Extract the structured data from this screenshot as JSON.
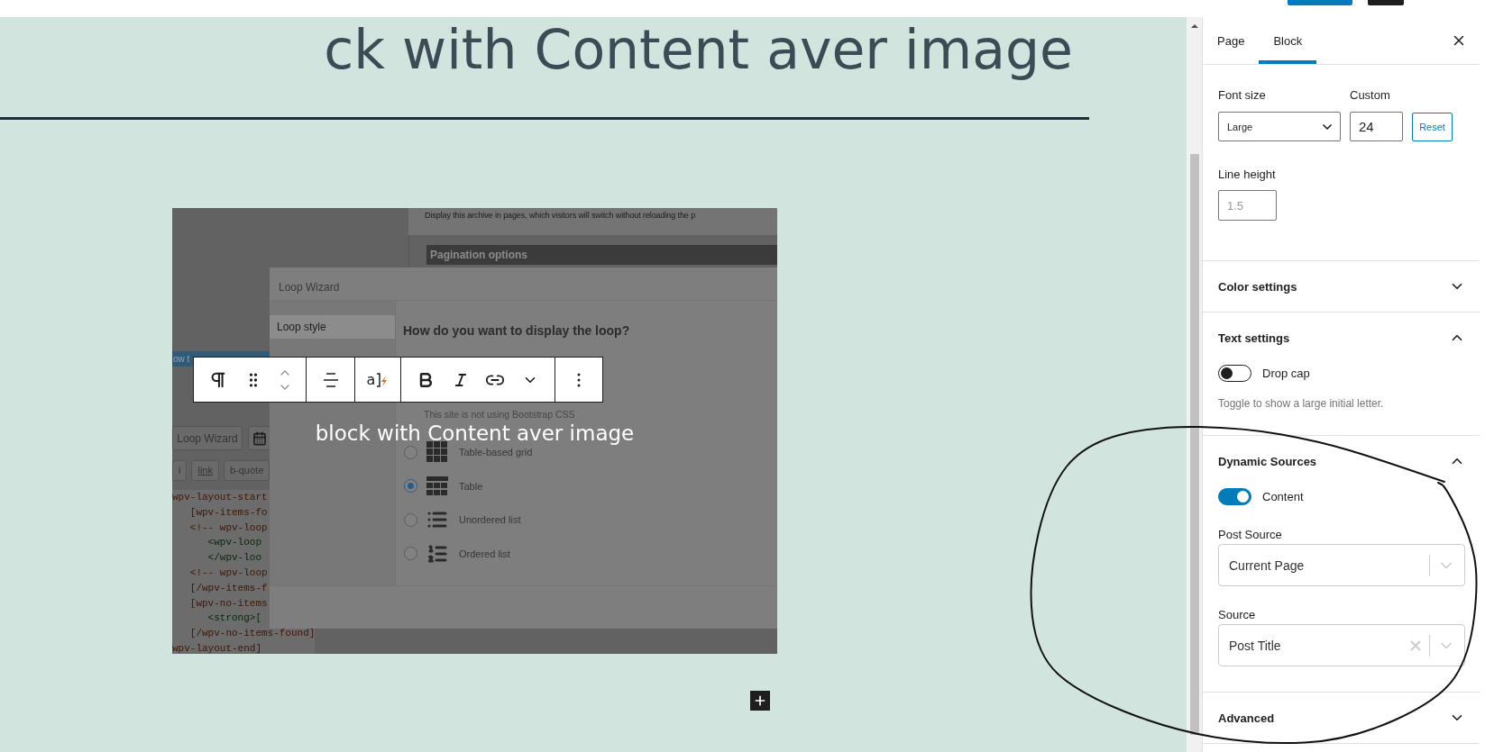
{
  "editor_title": "ck with Content aver image",
  "cover": {
    "text": "block with Content aver image",
    "toolbar": {
      "format_glyph": "a"
    },
    "screenshot": {
      "description": "Display this archive in pages, which visitors will switch without reloading the p",
      "section": "Pagination options",
      "notice": "ow t",
      "button": "Loop Wizard",
      "quicktags": [
        "i",
        "link",
        "b-quote"
      ],
      "code": [
        {
          "text": "wpv-layout-start",
          "kind": "shortcode"
        },
        {
          "text": "   [wpv-items-fo",
          "kind": "shortcode"
        },
        {
          "text": "   <!-- wpv-loop",
          "kind": "shortcode"
        },
        {
          "text": "      <wpv-loop",
          "kind": "html"
        },
        {
          "text": "      </wpv-loo",
          "kind": "html"
        },
        {
          "text": "   <!-- wpv-loop",
          "kind": "shortcode"
        },
        {
          "text": "   [/wpv-items-f",
          "kind": "shortcode"
        },
        {
          "text": "   [wpv-no-items",
          "kind": "shortcode"
        },
        {
          "text": "      <strong>[",
          "kind": "html"
        },
        {
          "text": "   [/wpv-no-items-found]",
          "kind": "shortcode"
        },
        {
          "text": "wpv-layout-end]",
          "kind": "shortcode"
        }
      ],
      "dialog": {
        "title": "Loop Wizard",
        "steps": [
          {
            "label": "Loop style",
            "selected": true
          }
        ],
        "question": "How do you want to display the loop?",
        "note": "This site is not using Bootstrap CSS",
        "options": [
          {
            "label": "Table-based grid",
            "kind": "grid",
            "selected": false
          },
          {
            "label": "Table",
            "kind": "table",
            "selected": true
          },
          {
            "label": "Unordered list",
            "kind": "ul",
            "selected": false
          },
          {
            "label": "Ordered list",
            "kind": "ol",
            "selected": false
          }
        ]
      }
    }
  },
  "sidebar": {
    "tabs": [
      {
        "label": "Page",
        "selected": false
      },
      {
        "label": "Block",
        "selected": true
      }
    ],
    "typography": {
      "font_size_label": "Font size",
      "custom_label": "Custom",
      "font_size": "Large",
      "custom_value": "24",
      "reset": "Reset",
      "line_height_label": "Line height",
      "line_height_placeholder": "1.5"
    },
    "panels": [
      {
        "title": "Color settings",
        "expanded": false
      },
      {
        "title": "Text settings",
        "expanded": true,
        "toggle": {
          "label": "Drop cap",
          "on": false
        },
        "help": "Toggle to show a large initial letter."
      },
      {
        "title": "Dynamic Sources",
        "expanded": true,
        "toggle": {
          "label": "Content",
          "on": true
        },
        "selects": [
          {
            "label": "Post Source",
            "value": "Current Page",
            "clearable": false
          },
          {
            "label": "Source",
            "value": "Post Title",
            "clearable": true
          }
        ]
      },
      {
        "title": "Advanced",
        "expanded": false
      }
    ]
  }
}
